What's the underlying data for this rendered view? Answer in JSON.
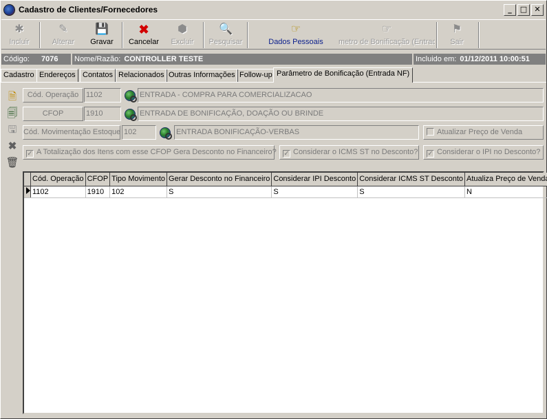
{
  "window": {
    "title": "Cadastro de Clientes/Fornecedores"
  },
  "toolbar": {
    "incluir": "Incluir",
    "alterar": "Alterar",
    "gravar": "Gravar",
    "cancelar": "Cancelar",
    "excluir": "Excluir",
    "pesquisar": "Pesquisar",
    "dados_pessoais": "Dados Pessoais",
    "parametro_bonif": "metro de Bonificação (Entrac",
    "sair": "Sair"
  },
  "info": {
    "codigo_label": "Código:",
    "codigo_value": "7076",
    "nome_label": "Nome/Razão:",
    "nome_value": "CONTROLLER TESTE",
    "incluido_label": "Incluido em:",
    "incluido_value": "01/12/2011 10:00:51"
  },
  "tabs": [
    "Cadastro",
    "Endereços",
    "Contatos",
    "Relacionados",
    "Outras Informações",
    "Follow-up",
    "Parâmetro de Bonificação (Entrada NF)"
  ],
  "form": {
    "cod_operacao_label": "Cód. Operação",
    "cod_operacao_value": "1102",
    "cod_operacao_desc": "ENTRADA - COMPRA PARA COMERCIALIZACAO",
    "cfop_label": "CFOP",
    "cfop_value": "1910",
    "cfop_desc": "ENTRADA DE BONIFICAÇÃO, DOAÇÃO OU BRINDE",
    "mov_estoque_label": "Cód. Movimentação Estoque",
    "mov_estoque_value": "102",
    "mov_estoque_desc": "ENTRADA BONIFICAÇÃO-VERBAS",
    "atualizar_preco_label": "Atualizar Preço de Venda",
    "atualizar_preco_checked": false,
    "totalizacao_label": "A Totalização dos Itens com esse CFOP Gera Desconto no Financeiro?",
    "totalizacao_checked": true,
    "icms_st_label": "Considerar o ICMS ST no Desconto?",
    "icms_st_checked": true,
    "ipi_label": "Considerar o IPI no Desconto?",
    "ipi_checked": true
  },
  "grid": {
    "columns": [
      "Cód. Operação",
      "CFOP",
      "Tipo Movimento",
      "Gerar Desconto no Financeiro",
      "Considerar IPI Desconto",
      "Considerar ICMS ST Desconto",
      "Atualiza Preço de Venda"
    ],
    "rows": [
      [
        "1102",
        "1910",
        "102",
        "S",
        "S",
        "S",
        "N"
      ]
    ]
  }
}
